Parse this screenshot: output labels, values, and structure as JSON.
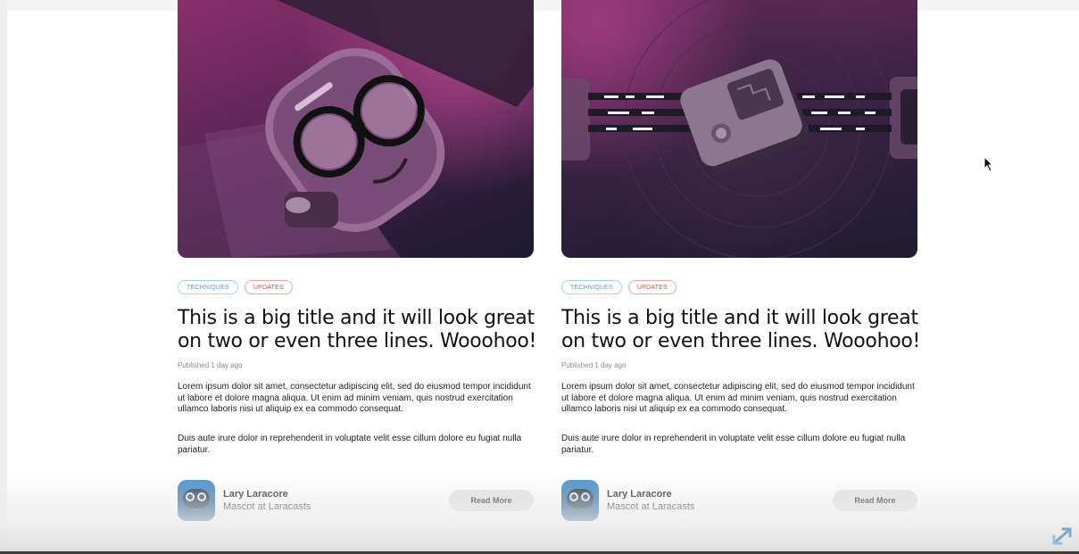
{
  "cards": [
    {
      "tags": [
        {
          "label": "TECHNIQUES"
        },
        {
          "label": "UPDATES"
        }
      ],
      "title": "This is a big title and it will look great on two or even three lines. Wooohoo!",
      "published": "Published 1 day ago",
      "body": [
        "Lorem ipsum dolor sit amet, consectetur adipiscing elit, sed do eiusmod tempor incididunt ut labore et dolore magna aliqua. Ut enim ad minim veniam, quis nostrud exercitation ullamco laboris nisi ut aliquip ex ea commodo consequat.",
        "Duis aute irure dolor in reprehenderit in voluptate velit esse cillum dolore eu fugiat nulla pariatur."
      ],
      "author": {
        "name": "Lary Laracore",
        "role": "Mascot at Laracasts"
      },
      "read_more_label": "Read More",
      "image_icon": "robot-with-glasses-illustration"
    },
    {
      "tags": [
        {
          "label": "TECHNIQUES"
        },
        {
          "label": "UPDATES"
        }
      ],
      "title": "This is a big title and it will look great on two or even three lines. Wooohoo!",
      "published": "Published 1 day ago",
      "body": [
        "Lorem ipsum dolor sit amet, consectetur adipiscing elit, sed do eiusmod tempor incididunt ut labore et dolore magna aliqua. Ut enim ad minim veniam, quis nostrud exercitation ullamco laboris nisi ut aliquip ex ea commodo consequat.",
        "Duis aute irure dolor in reprehenderit in voluptate velit esse cillum dolore eu fugiat nulla pariatur."
      ],
      "author": {
        "name": "Lary Laracore",
        "role": "Mascot at Laracasts"
      },
      "read_more_label": "Read More",
      "image_icon": "device-data-transfer-illustration"
    }
  ],
  "colors": {
    "tag_techniques": "#4aa6d3",
    "tag_updates": "#d84f4f",
    "read_more_bg": "#e2e2e2"
  }
}
